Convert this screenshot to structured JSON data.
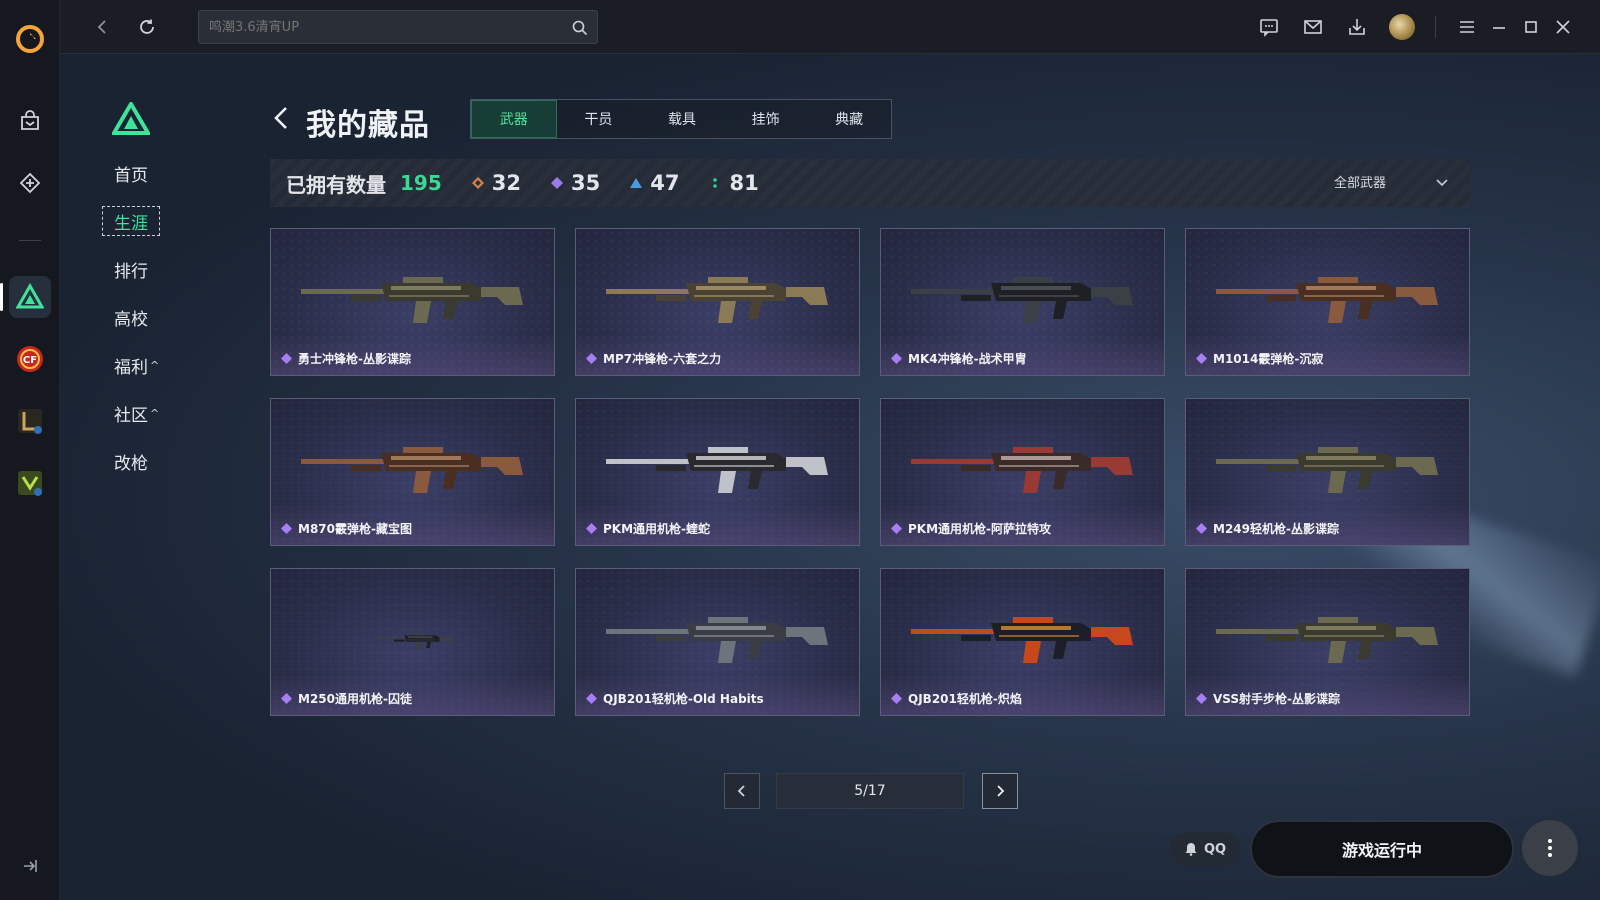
{
  "topbar": {
    "search_placeholder": "鸣潮3.6清宵UP"
  },
  "subnav": {
    "items": [
      {
        "label": "首页"
      },
      {
        "label": "生涯",
        "active": true
      },
      {
        "label": "排行"
      },
      {
        "label": "高校"
      },
      {
        "label": "福利",
        "caret": "^"
      },
      {
        "label": "社区",
        "caret": "^"
      },
      {
        "label": "改枪"
      }
    ]
  },
  "header": {
    "title": "我的藏品",
    "tabs": [
      "武器",
      "干员",
      "载具",
      "挂饰",
      "典藏"
    ]
  },
  "stats": {
    "owned_label": "已拥有数量",
    "owned_count": "195",
    "tiers": [
      {
        "count": "32",
        "color": "#e0874a"
      },
      {
        "count": "35",
        "color": "#a67ff2"
      },
      {
        "count": "47",
        "color": "#4fa3e8"
      },
      {
        "count": "81",
        "color": "#3fd39a"
      }
    ],
    "filter_label": "全部武器"
  },
  "items": [
    {
      "name": "勇士冲锋枪-丛影谍踪",
      "skin": "camo"
    },
    {
      "name": "MP7冲锋枪-六套之力",
      "skin": "sand"
    },
    {
      "name": "MK4冲锋枪-战术甲胄",
      "skin": "dark"
    },
    {
      "name": "M1014霰弹枪-沉寂",
      "skin": "copper"
    },
    {
      "name": "M870霰弹枪-藏宝图",
      "skin": "copper"
    },
    {
      "name": "PKM通用机枪-蝰蛇",
      "skin": "white"
    },
    {
      "name": "PKM通用机枪-阿萨拉特攻",
      "skin": "red"
    },
    {
      "name": "M249轻机枪-丛影谍踪",
      "skin": "camo"
    },
    {
      "name": "M250通用机枪-囚徒",
      "skin": "dark"
    },
    {
      "name": "QJB201轻机枪-Old Habits",
      "skin": "steel"
    },
    {
      "name": "QJB201轻机枪-炽焰",
      "skin": "fire"
    },
    {
      "name": "VSS射手步枪-丛影谍踪",
      "skin": "camo"
    }
  ],
  "item_tier_color": "#a67ff2",
  "pagination": {
    "text": "5/17"
  },
  "footer": {
    "qq_label": "QQ",
    "launch_label": "游戏运行中"
  },
  "colors": {
    "accent": "#3fe39a"
  }
}
